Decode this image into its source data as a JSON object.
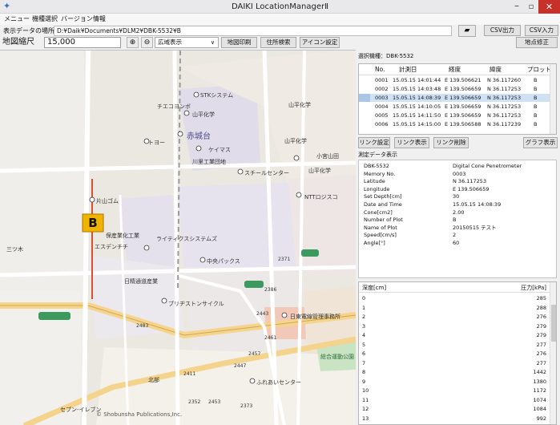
{
  "window": {
    "title": "DAIKI LocationManagerⅡ",
    "min": "–",
    "max": "▫",
    "close": "✕"
  },
  "menu": [
    "メニュー",
    "機種選択",
    "バージョン情報"
  ],
  "path": {
    "label": "表示データの場所",
    "value": "D:¥Daik¥Documents¥DLM2¥DBK-5532¥B"
  },
  "toolbar_top": {
    "csv_out": "CSV出力",
    "csv_in": "CSV入力",
    "point_fix": "地点修正"
  },
  "map_toolbar": {
    "scale_label": "地図縮尺",
    "scale_value": "15,000",
    "display_option": "広域表示",
    "print": "地図印刷",
    "address_search": "住所検索",
    "icon_settings": "アイコン設定"
  },
  "map": {
    "labels": {
      "l1": "STKシステム",
      "l2": "チエコヨンボ",
      "l3": "山平化学",
      "l4": "赤城台",
      "l5": "ケイマス",
      "l6": "トヨー",
      "l7": "小宮山田",
      "l8": "川里工業団地",
      "l9": "スチールセンター",
      "l10": "NTTロジスコ",
      "l11": "片山ゴム",
      "l12": "保産業化工業",
      "l13": "エスデンチチ",
      "l14": "ライティクスシステムズ",
      "l15": "中央パックス",
      "l16": "日精通道産業",
      "l17": "ブリヂストンサイクル",
      "l18": "日東電線管理事務所",
      "l19": "北部",
      "l20": "ふれあいセンター",
      "l21": "セブン-イレブン",
      "l22": "山平化学",
      "l23": "山平化学",
      "l24": "山平化学",
      "l25": "総合運動公園",
      "l26": "三ツ木"
    },
    "route_numbers": [
      "2443",
      "2447",
      "2453",
      "2457",
      "2461",
      "2483",
      "2371",
      "2411",
      "2352",
      "2373",
      "2386"
    ],
    "copyright": "© Shobunsha Publications,Inc.",
    "marker_letter": "B"
  },
  "right_panel": {
    "selected_model": "選択機種：DBK-5532",
    "columns": [
      "No.",
      "計測日",
      "経度",
      "緯度",
      "プロット"
    ],
    "rows": [
      {
        "no": "0001",
        "date": "15.05.15 14:01:44",
        "lon": "E 139.506621",
        "lat": "N 36.117260",
        "plot": "B"
      },
      {
        "no": "0002",
        "date": "15.05.15 14:03:48",
        "lon": "E 139.506659",
        "lat": "N 36.117253",
        "plot": "B"
      },
      {
        "no": "0003",
        "date": "15.05.15 14:08:39",
        "lon": "E 139.506659",
        "lat": "N 36.117253",
        "plot": "B"
      },
      {
        "no": "0004",
        "date": "15.05.15 14:10:05",
        "lon": "E 139.506659",
        "lat": "N 36.117253",
        "plot": "B"
      },
      {
        "no": "0005",
        "date": "15.05.15 14:11:50",
        "lon": "E 139.506659",
        "lat": "N 36.117253",
        "plot": "B"
      },
      {
        "no": "0006",
        "date": "15.05.15 14:15:00",
        "lon": "E 139.506588",
        "lat": "N 36.117239",
        "plot": "B"
      }
    ],
    "selected_row": 2,
    "buttons": {
      "link_settings": "リンク設定",
      "link_show": "リンク表示",
      "link_delete": "リンク削除",
      "graph_show": "グラフ表示"
    }
  },
  "data_display": {
    "title": "測定データ表示",
    "fields": [
      {
        "key": "DBK-5532",
        "val": "Digital Cone Penetrometer"
      },
      {
        "key": "Memory No.",
        "val": "0003"
      },
      {
        "key": "Latitude",
        "val": "N 36.117253"
      },
      {
        "key": "Longitude",
        "val": "E 139.506659"
      },
      {
        "key": "Set Depth[cm]",
        "val": "30"
      },
      {
        "key": "Date and Time",
        "val": "15.05.15 14:08:39"
      },
      {
        "key": "Cone[cm2]",
        "val": "2.00"
      },
      {
        "key": "Number of Plot",
        "val": "B"
      },
      {
        "key": "Name of Plot",
        "val": "20150515 テスト"
      },
      {
        "key": "Speed[cm/s]",
        "val": "2"
      },
      {
        "key": "Angle[°]",
        "val": "60"
      }
    ]
  },
  "depth_table": {
    "col_depth": "深度[cm]",
    "col_pressure": "圧力[kPa]",
    "rows": [
      [
        "0",
        "285"
      ],
      [
        "1",
        "288"
      ],
      [
        "2",
        "276"
      ],
      [
        "3",
        "279"
      ],
      [
        "4",
        "279"
      ],
      [
        "5",
        "277"
      ],
      [
        "6",
        "276"
      ],
      [
        "7",
        "277"
      ],
      [
        "8",
        "1442"
      ],
      [
        "9",
        "1380"
      ],
      [
        "10",
        "1172"
      ],
      [
        "11",
        "1074"
      ],
      [
        "12",
        "1084"
      ],
      [
        "13",
        "992"
      ]
    ]
  },
  "colors": {
    "accent_marker": "#f0b400",
    "selected_row": "#cfe2f5",
    "close": "#c8302a"
  }
}
